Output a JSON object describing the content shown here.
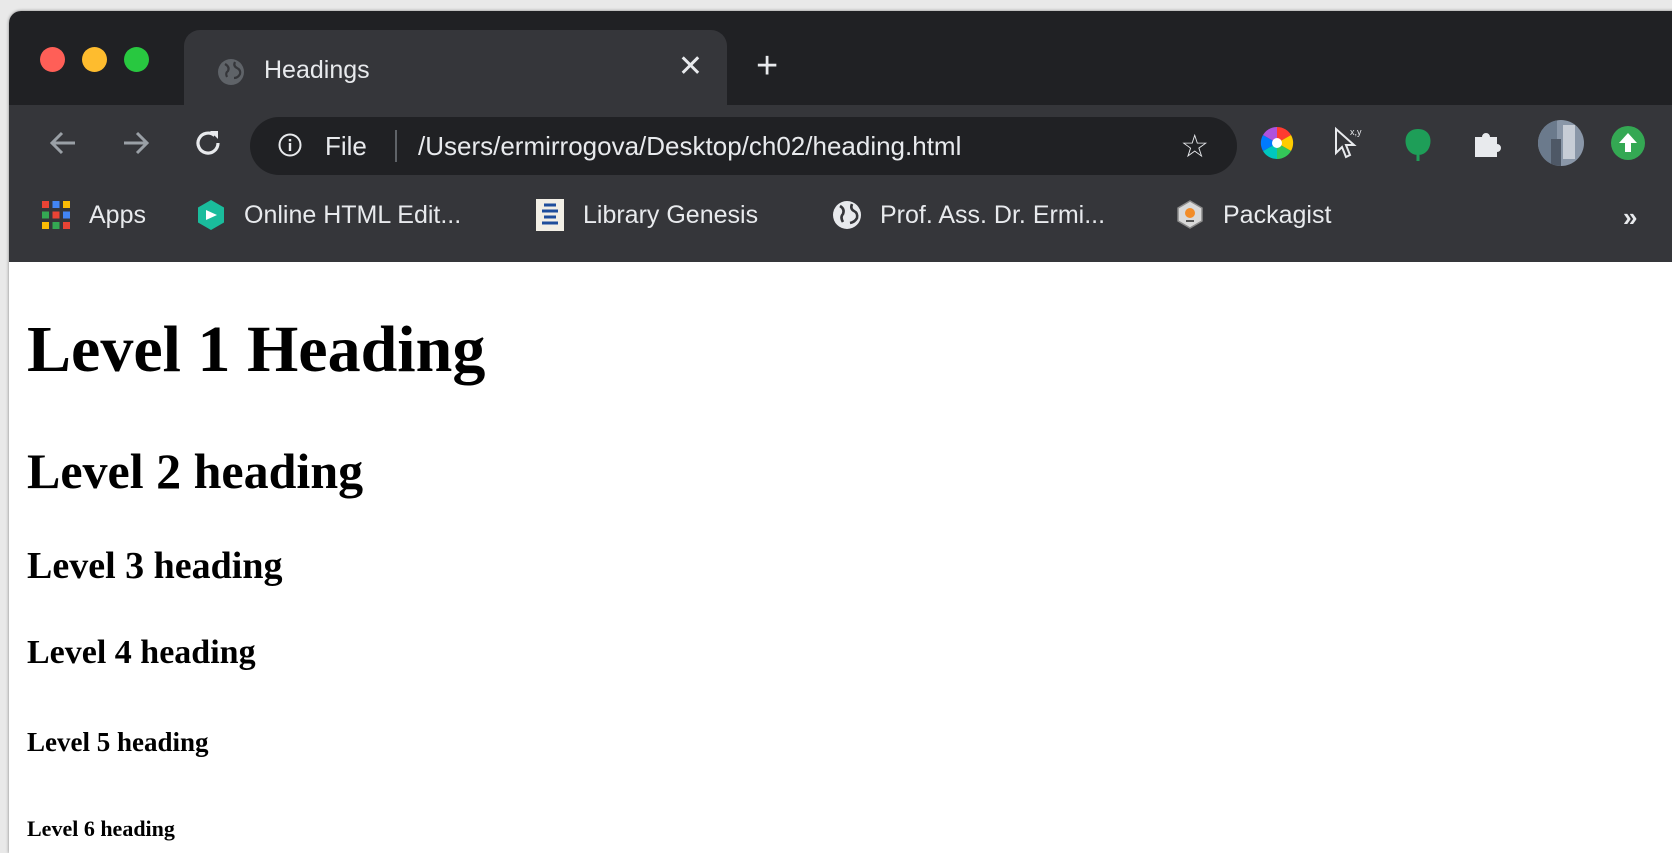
{
  "window": {
    "tab_title": "Headings",
    "new_tab_label": "+",
    "close_tab_label": "✕"
  },
  "address_bar": {
    "scheme_label": "File",
    "url": "/Users/ermirrogova/Desktop/ch02/heading.html"
  },
  "extensions": [
    "color-wheel-icon",
    "cursor-xy-icon",
    "green-leaf-icon",
    "puzzle-icon",
    "avatar",
    "upload-icon"
  ],
  "bookmarks": {
    "items": [
      {
        "label": "Apps",
        "icon": "apps-grid-icon"
      },
      {
        "label": "Online HTML Edit...",
        "icon": "html-editor-icon"
      },
      {
        "label": "Library Genesis",
        "icon": "library-icon"
      },
      {
        "label": "Prof. Ass. Dr. Ermi...",
        "icon": "globe-icon"
      },
      {
        "label": "Packagist",
        "icon": "packagist-icon"
      }
    ],
    "more_label": "»"
  },
  "page": {
    "h1": "Level 1 Heading",
    "h2": "Level 2 heading",
    "h3": "Level 3 heading",
    "h4": "Level 4 heading",
    "h5": "Level 5 heading",
    "h6": "Level 6 heading"
  },
  "colors": {
    "tabbar_bg": "#202124",
    "toolbar_bg": "#35363a",
    "close_red": "#ff5f57",
    "minimize_yellow": "#febc2e",
    "maximize_green": "#28c840"
  }
}
